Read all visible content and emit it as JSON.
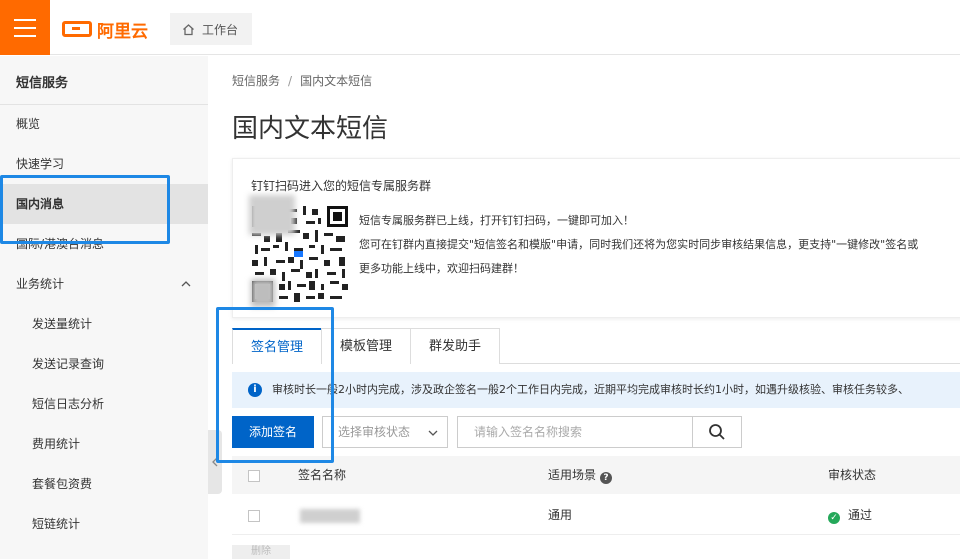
{
  "brand": {
    "logo_text": "阿里云",
    "accent": "#ff6a00"
  },
  "topbar": {
    "workbench_label": "工作台"
  },
  "sidebar": {
    "title": "短信服务",
    "items": [
      {
        "label": "概览"
      },
      {
        "label": "快速学习"
      },
      {
        "label": "国内消息"
      },
      {
        "label": "国际/港澳台消息"
      },
      {
        "label": "业务统计"
      },
      {
        "label": "发送量统计"
      },
      {
        "label": "发送记录查询"
      },
      {
        "label": "短信日志分析"
      },
      {
        "label": "费用统计"
      },
      {
        "label": "套餐包资费"
      },
      {
        "label": "短链统计"
      }
    ]
  },
  "breadcrumb": {
    "root": "短信服务",
    "sep": "/",
    "current": "国内文本短信"
  },
  "page": {
    "title": "国内文本短信"
  },
  "promo": {
    "title": "钉钉扫码进入您的短信专属服务群",
    "lines": [
      "短信专属服务群已上线，打开钉钉扫码，一键即可加入！",
      "您可在钉群内直接提交\"短信签名和模版\"申请，同时我们还将为您实时同步审核结果信息，更支持\"一键修改\"签名或",
      "更多功能上线中，欢迎扫码建群！"
    ]
  },
  "tabs": [
    {
      "label": "签名管理"
    },
    {
      "label": "模板管理"
    },
    {
      "label": "群发助手"
    }
  ],
  "notice": {
    "text": "审核时长一般2小时内完成，涉及政企签名一般2个工作日内完成，近期平均完成审核时长约1小时，如遇升级核验、审核任务较多、"
  },
  "toolbar": {
    "add_label": "添加签名",
    "select_placeholder": "选择审核状态",
    "search_placeholder": "请输入签名名称搜索"
  },
  "table": {
    "headers": {
      "name": "签名名称",
      "scene": "适用场景",
      "status": "审核状态"
    },
    "rows": [
      {
        "scene": "通用",
        "status": "通过"
      }
    ],
    "bottom_button": "删除"
  },
  "colors": {
    "primary": "#0064c8",
    "highlight": "#1e88e5",
    "success": "#25a85a"
  }
}
